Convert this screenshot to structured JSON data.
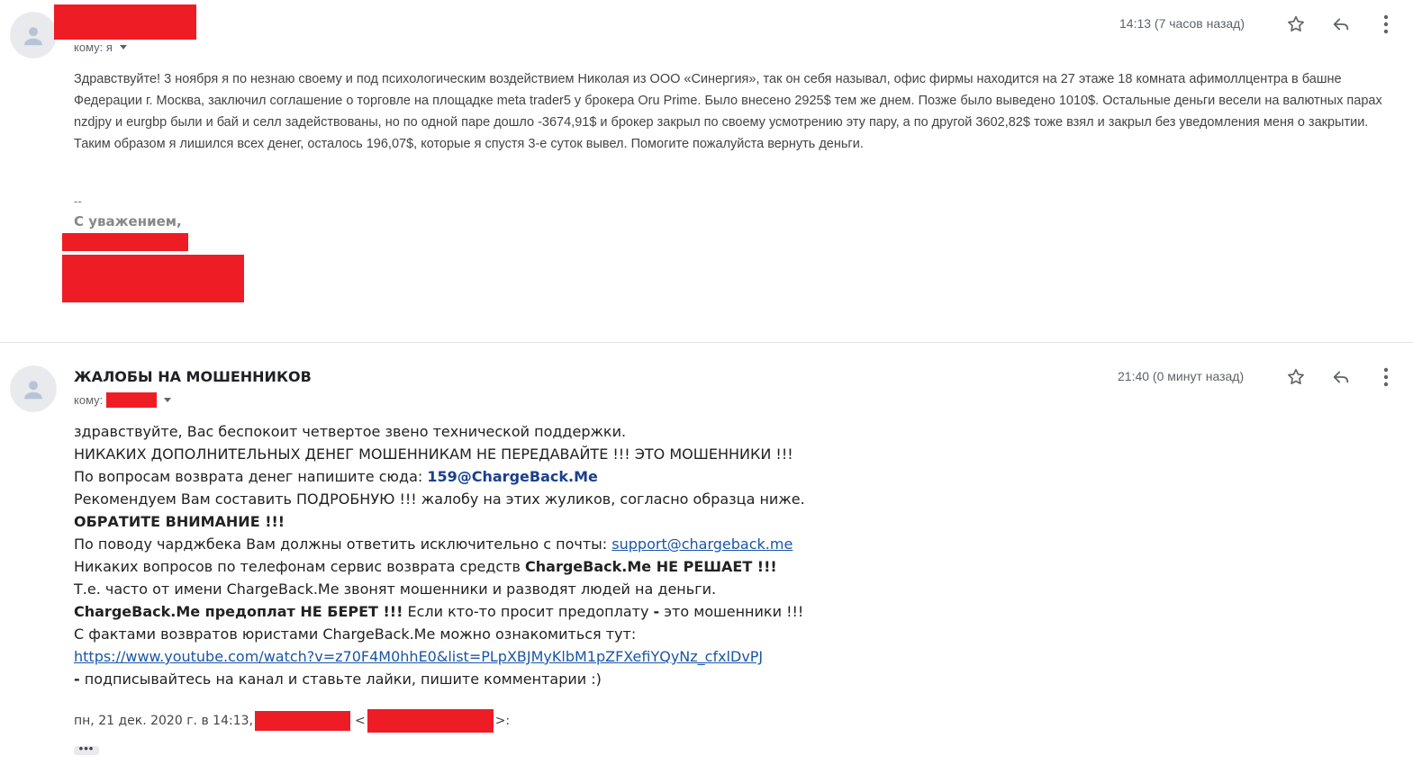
{
  "message1": {
    "time": "14:13 (7 часов назад)",
    "to_label": "кому: я",
    "paragraph": "Здравствуйте! 3 ноября я по незнаю своему и под психологическим воздействием Николая из ООО «Синергия», так он себя называл, офис фирмы находится на 27 этаже 18 комната афимоллцентра в башне Федерации г. Москва,  заключил соглашение о торговле на площадке meta trader5  у брокера Oru Prime. Было внесено 2925$ тем же днем. Позже было выведено 1010$. Остальные деньги весели на валютных парах nzdjpy и eurgbp были и бай и селл задействованы, но по одной паре дошло -3674,91$ и брокер закрыл по своему усмотрению эту пару, а по другой 3602,82$ тоже взял и закрыл без уведомления меня о закрытии. Таким образом  я лишился всех денег, осталось 196,07$, которые я спустя 3-е суток вывел. Помогите пожалуйста вернуть деньги.",
    "sig_dash": "--",
    "signature": "С уважением,"
  },
  "message2": {
    "sender": "ЖАЛОБЫ НА МОШЕННИКОВ",
    "time": "21:40 (0 минут назад)",
    "to_label": "кому:",
    "line1": "здравствуйте, Вас беспокоит четвертое звено технической поддержки.",
    "line2": "НИКАКИХ ДОПОЛНИТЕЛЬНЫХ ДЕНЕГ МОШЕННИКАМ НЕ ПЕРЕДАВАЙТЕ !!! ЭТО МОШЕННИКИ !!!",
    "line3_text": "По вопросам возврата денег напишите сюда: ",
    "line3_email": "159@ChargeBack.Me",
    "line4": "Рекомендуем Вам составить ПОДРОБНУЮ !!! жалобу на этих жуликов, согласно образца ниже.",
    "line5": "ОБРАТИТЕ ВНИМАНИЕ !!!",
    "line6_text": "По поводу чарджбека Вам должны ответить исключительно с почты: ",
    "line6_link": "support@chargeback.me",
    "line7_text": "Никаких вопросов по телефонам сервис возврата средств ",
    "line7_bold": "ChargeBack.Me НЕ РЕШАЕТ !!!",
    "line8": "Т.е. часто от имени ChargeBack.Me звонят мошенники и разводят людей на деньги.",
    "line9_bold": "ChargeBack.Me предоплат НЕ БЕРЕТ !!!",
    "line9_text": " Если кто-то просит предоплату ",
    "line9_dash": "-",
    "line9_end": " это мошенники !!!",
    "line10": "С фактами возвратов юристами ChargeBack.Me можно ознакомиться тут:",
    "line11_link": "https://www.youtube.com/watch?v=z70F4M0hhE0&list=PLpXBJMyKlbM1pZFXefiYQyNz_cfxlDvPJ",
    "line12_dash": " -",
    "line12_text": " подписывайтесь на канал и ставьте лайки, пишите комментарии :)",
    "quote_date": "пн, 21 дек. 2020 г. в 14:13,",
    "quote_lt": "<",
    "quote_gt": ">:",
    "show_trimmed": "•••"
  },
  "icons": [
    "person-avatar-icon",
    "star-icon",
    "reply-icon",
    "more-vert-icon"
  ],
  "colors": {
    "redaction": "#ee1c25",
    "link": "#1a56a6",
    "email_bold": "#1a3f8f"
  }
}
